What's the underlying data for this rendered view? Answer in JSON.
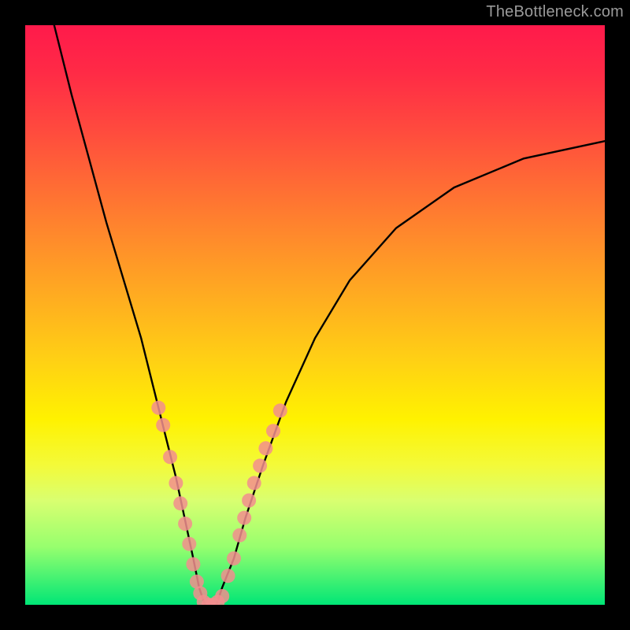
{
  "watermark": {
    "text": "TheBottleneck.com"
  },
  "chart_data": {
    "type": "line",
    "title": "",
    "xlabel": "",
    "ylabel": "",
    "xlim": [
      0,
      100
    ],
    "ylim": [
      0,
      100
    ],
    "grid": false,
    "series": [
      {
        "name": "bottleneck-curve",
        "type": "line",
        "color": "#000000",
        "x": [
          5,
          8,
          11,
          14,
          17,
          20,
          22,
          24,
          26,
          27.5,
          29,
          30,
          31,
          32,
          33,
          34,
          36,
          38,
          41,
          45,
          50,
          56,
          64,
          74,
          86,
          100
        ],
        "y": [
          100,
          88,
          77,
          66,
          56,
          46,
          38,
          30,
          22,
          15,
          8,
          3,
          0,
          0,
          0,
          3,
          8,
          15,
          24,
          35,
          46,
          56,
          65,
          72,
          77,
          80
        ]
      },
      {
        "name": "marker-cluster-left",
        "type": "scatter",
        "color": "#f28e8e",
        "x": [
          23.0,
          23.8,
          25.0,
          26.0,
          26.8,
          27.6,
          28.3,
          29.0,
          29.6,
          30.2
        ],
        "y": [
          34.0,
          31.0,
          25.5,
          21.0,
          17.5,
          14.0,
          10.5,
          7.0,
          4.0,
          2.0
        ]
      },
      {
        "name": "marker-cluster-right",
        "type": "scatter",
        "color": "#f28e8e",
        "x": [
          35.0,
          36.0,
          37.0,
          37.8,
          38.6,
          39.5,
          40.5,
          41.5,
          42.8,
          44.0
        ],
        "y": [
          5.0,
          8.0,
          12.0,
          15.0,
          18.0,
          21.0,
          24.0,
          27.0,
          30.0,
          33.5
        ]
      },
      {
        "name": "marker-cluster-bottom",
        "type": "scatter",
        "color": "#f28e8e",
        "x": [
          30.8,
          31.6,
          32.4,
          33.2,
          34.0
        ],
        "y": [
          0.5,
          0.0,
          0.0,
          0.5,
          1.5
        ]
      }
    ]
  }
}
